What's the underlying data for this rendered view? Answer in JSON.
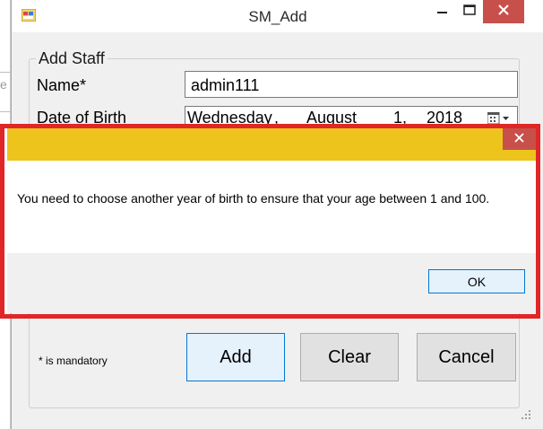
{
  "window": {
    "title": "SM_Add",
    "close_color": "#c7504b"
  },
  "background": {
    "edge_text": "e"
  },
  "form": {
    "group_title": "Add Staff",
    "name_label": "Name*",
    "name_value": "admin111",
    "dob_label": "Date of Birth",
    "dob": {
      "weekday": "Wednesday",
      "sep": ",",
      "month": "August",
      "day": "1,",
      "year": "2018"
    },
    "mandatory_note": "* is mandatory",
    "buttons": {
      "add": "Add",
      "clear": "Clear",
      "cancel": "Cancel"
    }
  },
  "dialog": {
    "message": "You need to choose another year of birth to ensure that your age between 1 and 100.",
    "ok_label": "OK",
    "title_color": "#edc41c",
    "highlight_color": "#e02626"
  }
}
